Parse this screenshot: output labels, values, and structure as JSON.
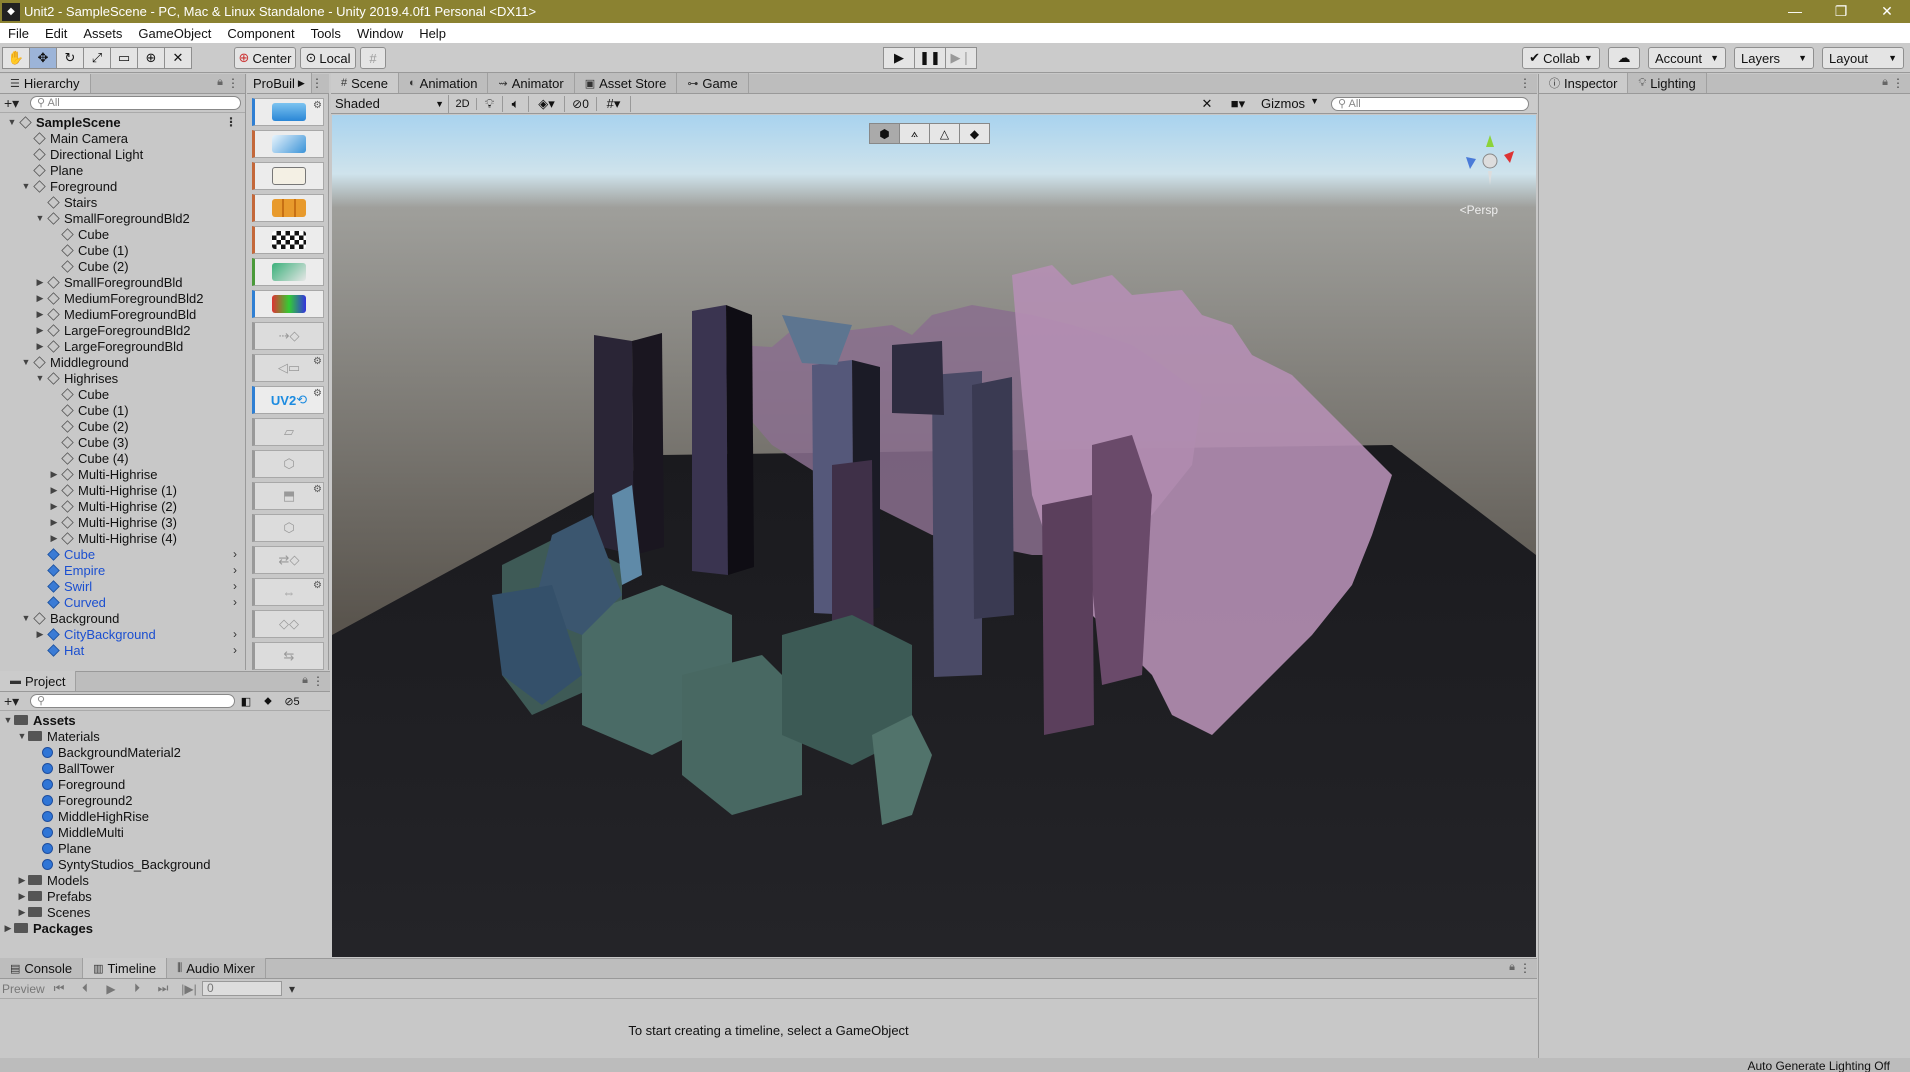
{
  "window": {
    "title": "Unit2 - SampleScene - PC, Mac & Linux Standalone - Unity 2019.4.0f1 Personal <DX11>"
  },
  "menu": [
    "File",
    "Edit",
    "Assets",
    "GameObject",
    "Component",
    "Tools",
    "Window",
    "Help"
  ],
  "toolbar": {
    "center_label": "Center",
    "local_label": "Local",
    "collab_label": "Collab",
    "account_label": "Account",
    "layers_label": "Layers",
    "layout_label": "Layout"
  },
  "hierarchy": {
    "tab": "Hierarchy",
    "search_placeholder": "All",
    "items": [
      {
        "label": "SampleScene",
        "depth": 0,
        "arrow": "▼",
        "type": "scene"
      },
      {
        "label": "Main Camera",
        "depth": 1,
        "arrow": "",
        "type": "obj"
      },
      {
        "label": "Directional Light",
        "depth": 1,
        "arrow": "",
        "type": "obj"
      },
      {
        "label": "Plane",
        "depth": 1,
        "arrow": "",
        "type": "obj"
      },
      {
        "label": "Foreground",
        "depth": 1,
        "arrow": "▼",
        "type": "obj"
      },
      {
        "label": "Stairs",
        "depth": 2,
        "arrow": "",
        "type": "obj"
      },
      {
        "label": "SmallForegroundBld2",
        "depth": 2,
        "arrow": "▼",
        "type": "obj"
      },
      {
        "label": "Cube",
        "depth": 3,
        "arrow": "",
        "type": "obj"
      },
      {
        "label": "Cube (1)",
        "depth": 3,
        "arrow": "",
        "type": "obj"
      },
      {
        "label": "Cube (2)",
        "depth": 3,
        "arrow": "",
        "type": "obj"
      },
      {
        "label": "SmallForegroundBld",
        "depth": 2,
        "arrow": "▶",
        "type": "obj"
      },
      {
        "label": "MediumForegroundBld2",
        "depth": 2,
        "arrow": "▶",
        "type": "obj"
      },
      {
        "label": "MediumForegroundBld",
        "depth": 2,
        "arrow": "▶",
        "type": "obj"
      },
      {
        "label": "LargeForegroundBld2",
        "depth": 2,
        "arrow": "▶",
        "type": "obj"
      },
      {
        "label": "LargeForegroundBld",
        "depth": 2,
        "arrow": "▶",
        "type": "obj"
      },
      {
        "label": "Middleground",
        "depth": 1,
        "arrow": "▼",
        "type": "obj"
      },
      {
        "label": "Highrises",
        "depth": 2,
        "arrow": "▼",
        "type": "obj"
      },
      {
        "label": "Cube",
        "depth": 3,
        "arrow": "",
        "type": "obj"
      },
      {
        "label": "Cube (1)",
        "depth": 3,
        "arrow": "",
        "type": "obj"
      },
      {
        "label": "Cube (2)",
        "depth": 3,
        "arrow": "",
        "type": "obj"
      },
      {
        "label": "Cube (3)",
        "depth": 3,
        "arrow": "",
        "type": "obj"
      },
      {
        "label": "Cube (4)",
        "depth": 3,
        "arrow": "",
        "type": "obj"
      },
      {
        "label": "Multi-Highrise",
        "depth": 3,
        "arrow": "▶",
        "type": "obj"
      },
      {
        "label": "Multi-Highrise (1)",
        "depth": 3,
        "arrow": "▶",
        "type": "obj"
      },
      {
        "label": "Multi-Highrise (2)",
        "depth": 3,
        "arrow": "▶",
        "type": "obj"
      },
      {
        "label": "Multi-Highrise (3)",
        "depth": 3,
        "arrow": "▶",
        "type": "obj"
      },
      {
        "label": "Multi-Highrise (4)",
        "depth": 3,
        "arrow": "▶",
        "type": "obj"
      },
      {
        "label": "Cube",
        "depth": 2,
        "arrow": "",
        "type": "prefab"
      },
      {
        "label": "Empire",
        "depth": 2,
        "arrow": "",
        "type": "prefab"
      },
      {
        "label": "Swirl",
        "depth": 2,
        "arrow": "",
        "type": "prefab"
      },
      {
        "label": "Curved",
        "depth": 2,
        "arrow": "",
        "type": "prefab"
      },
      {
        "label": "Background",
        "depth": 1,
        "arrow": "▼",
        "type": "obj"
      },
      {
        "label": "CityBackground",
        "depth": 2,
        "arrow": "▶",
        "type": "prefab"
      },
      {
        "label": "Hat",
        "depth": 2,
        "arrow": "",
        "type": "prefab"
      }
    ]
  },
  "probuilder": {
    "tab": "ProBuil",
    "uv_label": "UV2"
  },
  "scene": {
    "tabs": [
      "Scene",
      "Animation",
      "Animator",
      "Asset Store",
      "Game"
    ],
    "shading_mode": "Shaded",
    "mode_2d": "2D",
    "hidden_count": "0",
    "gizmos_label": "Gizmos",
    "search_placeholder": "All",
    "persp_label": "Persp"
  },
  "inspector": {
    "tabs": [
      "Inspector",
      "Lighting"
    ]
  },
  "project": {
    "tab": "Project",
    "hidden_count": "5",
    "items": [
      {
        "label": "Assets",
        "depth": 0,
        "arrow": "▼",
        "type": "folder",
        "bold": true
      },
      {
        "label": "Materials",
        "depth": 1,
        "arrow": "▼",
        "type": "folder"
      },
      {
        "label": "BackgroundMaterial2",
        "depth": 2,
        "arrow": "",
        "type": "mat"
      },
      {
        "label": "BallTower",
        "depth": 2,
        "arrow": "",
        "type": "mat"
      },
      {
        "label": "Foreground",
        "depth": 2,
        "arrow": "",
        "type": "mat"
      },
      {
        "label": "Foreground2",
        "depth": 2,
        "arrow": "",
        "type": "mat"
      },
      {
        "label": "MiddleHighRise",
        "depth": 2,
        "arrow": "",
        "type": "mat"
      },
      {
        "label": "MiddleMulti",
        "depth": 2,
        "arrow": "",
        "type": "mat"
      },
      {
        "label": "Plane",
        "depth": 2,
        "arrow": "",
        "type": "mat"
      },
      {
        "label": "SyntyStudios_Background",
        "depth": 2,
        "arrow": "",
        "type": "mat"
      },
      {
        "label": "Models",
        "depth": 1,
        "arrow": "▶",
        "type": "folder"
      },
      {
        "label": "Prefabs",
        "depth": 1,
        "arrow": "▶",
        "type": "folder"
      },
      {
        "label": "Scenes",
        "depth": 1,
        "arrow": "▶",
        "type": "folder"
      },
      {
        "label": "Packages",
        "depth": 0,
        "arrow": "▶",
        "type": "folder",
        "bold": true
      }
    ]
  },
  "timeline": {
    "tabs": [
      "Console",
      "Timeline",
      "Audio Mixer"
    ],
    "preview_label": "Preview",
    "frame_value": "0",
    "empty_message": "To start creating a timeline, select a GameObject"
  },
  "status": {
    "right_text": "Auto Generate Lighting Off"
  }
}
